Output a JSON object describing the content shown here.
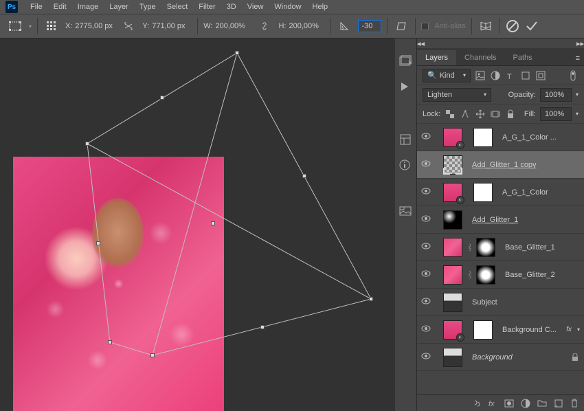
{
  "menu": [
    "File",
    "Edit",
    "Image",
    "Layer",
    "Type",
    "Select",
    "Filter",
    "3D",
    "View",
    "Window",
    "Help"
  ],
  "options": {
    "x_label": "X:",
    "x_value": "2775,00 px",
    "y_label": "Y:",
    "y_value": "771,00 px",
    "w_label": "W:",
    "w_value": "200,00%",
    "h_label": "H:",
    "h_value": "200,00%",
    "angle_value": "-30",
    "antialias_label": "Anti-alias"
  },
  "panel": {
    "tabs": [
      "Layers",
      "Channels",
      "Paths"
    ],
    "kind_label": "Kind",
    "blend_mode": "Lighten",
    "opacity_label": "Opacity:",
    "opacity_value": "100%",
    "lock_label": "Lock:",
    "fill_label": "Fill:",
    "fill_value": "100%"
  },
  "layers": [
    {
      "name": "A_G_1_Color ...",
      "visible": true,
      "selected": false,
      "thumb": "pink",
      "mask": "white",
      "adj": true
    },
    {
      "name": "Add_Glitter_1 copy",
      "visible": true,
      "selected": true,
      "thumb": "checker",
      "underline": true
    },
    {
      "name": "A_G_1_Color",
      "visible": true,
      "thumb": "pink",
      "mask": "white",
      "adj": true
    },
    {
      "name": "Add_Glitter_1",
      "visible": true,
      "thumb": "glitter",
      "underline": true
    },
    {
      "name": "Base_Glitter_1",
      "visible": true,
      "thumb": "pinkglitter",
      "mask": "maskblur",
      "link": true
    },
    {
      "name": "Base_Glitter_2",
      "visible": true,
      "thumb": "pinkglitter",
      "mask": "maskblur",
      "link": true
    },
    {
      "name": "Subject",
      "visible": true,
      "thumb": "subject"
    },
    {
      "name": "Background C...",
      "visible": true,
      "thumb": "pink",
      "mask": "white",
      "adj": true,
      "fx": true
    },
    {
      "name": "Background",
      "visible": true,
      "thumb": "subject",
      "italic": true,
      "locked": true
    }
  ]
}
